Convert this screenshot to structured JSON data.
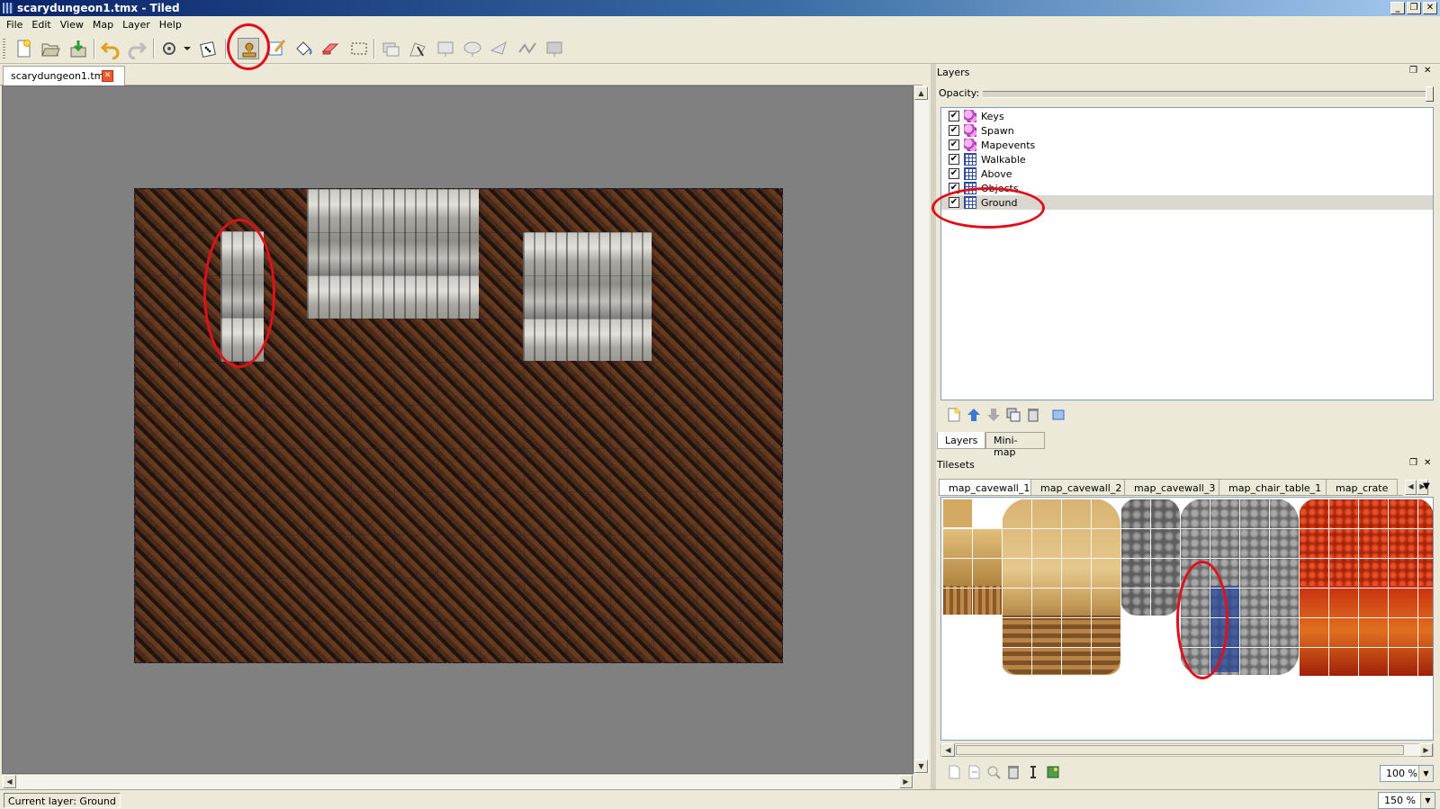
{
  "window": {
    "title": "scarydungeon1.tmx - Tiled",
    "buttons": [
      "_",
      "❐",
      "✕"
    ]
  },
  "menu": [
    "File",
    "Edit",
    "View",
    "Map",
    "Layer",
    "Help"
  ],
  "toolbar": {
    "icons": [
      "new-icon",
      "open-icon",
      "save-icon",
      "undo-icon",
      "redo-icon",
      "random-mode-icon",
      "dice-icon",
      "stamp-brush-icon",
      "terrain-brush-icon",
      "bucket-fill-icon",
      "eraser-icon",
      "rect-select-icon",
      "select-objects-icon",
      "edit-polygons-icon",
      "insert-rectangle-icon",
      "insert-ellipse-icon",
      "insert-polygon-icon",
      "insert-polyline-icon",
      "insert-tile-icon"
    ]
  },
  "document": {
    "tab_label": "scarydungeon1.tmx"
  },
  "layers_panel": {
    "title": "Layers",
    "opacity_label": "Opacity:",
    "opacity": 1.0,
    "layers": [
      {
        "name": "Keys",
        "type": "object",
        "visible": true
      },
      {
        "name": "Spawn",
        "type": "object",
        "visible": true
      },
      {
        "name": "Mapevents",
        "type": "object",
        "visible": true
      },
      {
        "name": "Walkable",
        "type": "tile",
        "visible": true
      },
      {
        "name": "Above",
        "type": "tile",
        "visible": true
      },
      {
        "name": "Objects",
        "type": "tile",
        "visible": true
      },
      {
        "name": "Ground",
        "type": "tile",
        "visible": true,
        "selected": true
      }
    ],
    "tabs": [
      "Layers",
      "Mini-map"
    ]
  },
  "tilesets_panel": {
    "title": "Tilesets",
    "tabs": [
      "map_cavewall_1",
      "map_cavewall_2",
      "map_cavewall_3",
      "map_chair_table_1",
      "map_crate"
    ],
    "active_tab": "map_cavewall_1",
    "zoom": "100 %"
  },
  "map_zoom": "150 %",
  "status": {
    "current_layer": "Current layer: Ground"
  },
  "colors": {
    "annotation": "#e0101a",
    "selection": "#2c4a9a",
    "titlebar": "#0a246a"
  }
}
